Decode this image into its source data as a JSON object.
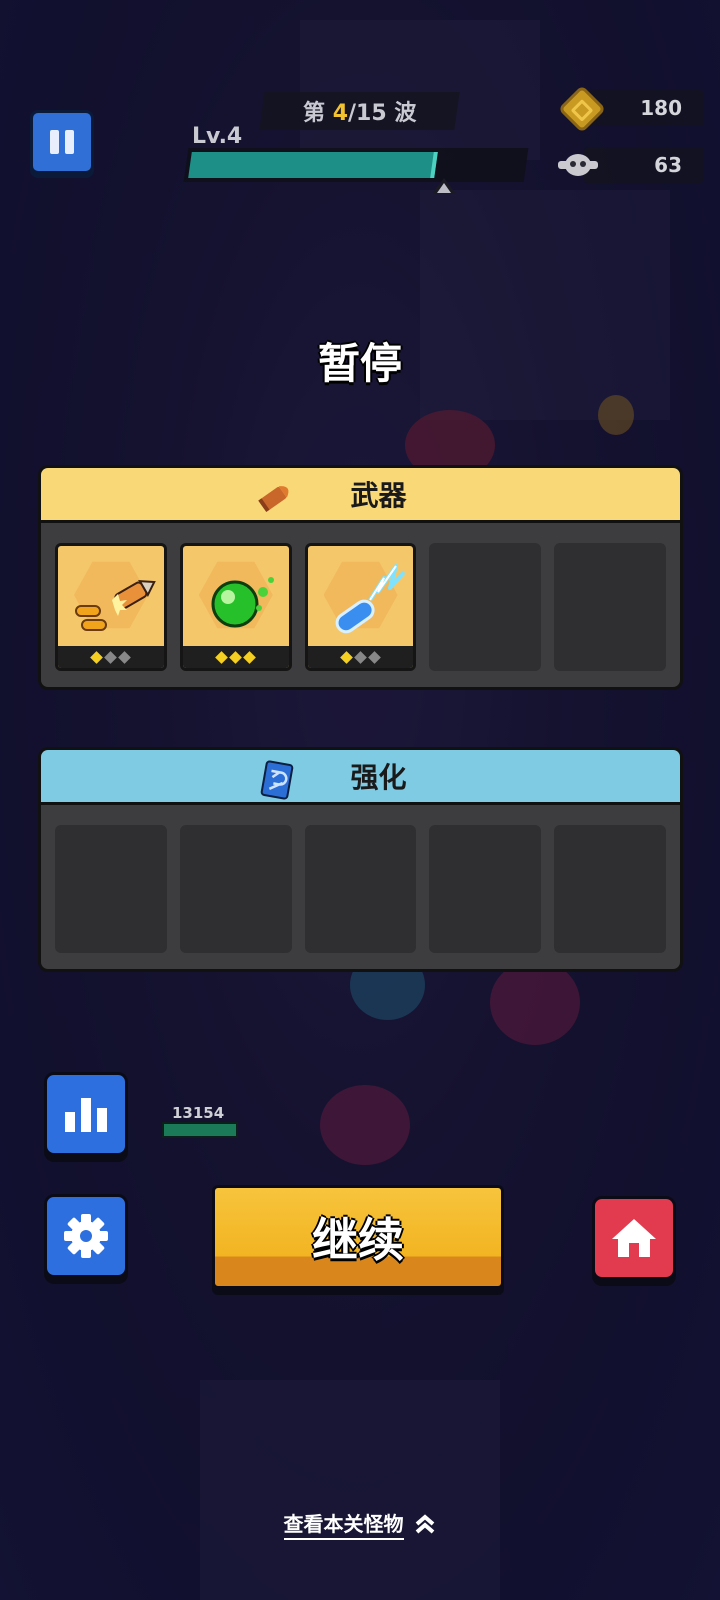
{
  "hud": {
    "wave_prefix": "第",
    "wave_current": "4",
    "wave_total": "/15",
    "wave_suffix": "波",
    "level": "Lv.4",
    "xp_progress": 0.74,
    "coins": "180",
    "kills": "63"
  },
  "title": "暂停",
  "weapons": {
    "label": "武器",
    "header_color": "#f9d877",
    "slots": [
      {
        "icon": "missile-icon",
        "stars": [
          true,
          false,
          false
        ]
      },
      {
        "icon": "green-orb-icon",
        "stars": [
          true,
          true,
          true
        ]
      },
      {
        "icon": "lightning-bolt-icon",
        "stars": [
          true,
          false,
          false
        ]
      },
      {
        "empty": true
      },
      {
        "empty": true
      }
    ]
  },
  "upgrades": {
    "label": "强化",
    "header_color": "#7ecbe3",
    "slots": [
      {
        "empty": true
      },
      {
        "empty": true
      },
      {
        "empty": true
      },
      {
        "empty": true
      },
      {
        "empty": true
      }
    ]
  },
  "damage_value": "13154",
  "continue_label": "继续",
  "footer_label": "查看本关怪物",
  "colors": {
    "button_blue": "#2e6fe0",
    "button_red": "#e23a4f",
    "button_yellow": "#f2b422"
  }
}
